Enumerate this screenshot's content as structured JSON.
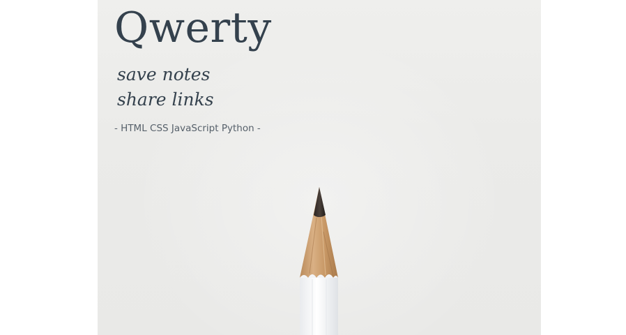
{
  "brand": {
    "title": "Qwerty",
    "tagline_line1": "save notes",
    "tagline_line2": "share links",
    "tech_stack": "- HTML CSS JavaScript Python -"
  },
  "colors": {
    "text_primary": "#34414d",
    "text_secondary": "#56606a",
    "background": "#ebebe9"
  },
  "images": {
    "hero": "pencil-icon"
  }
}
